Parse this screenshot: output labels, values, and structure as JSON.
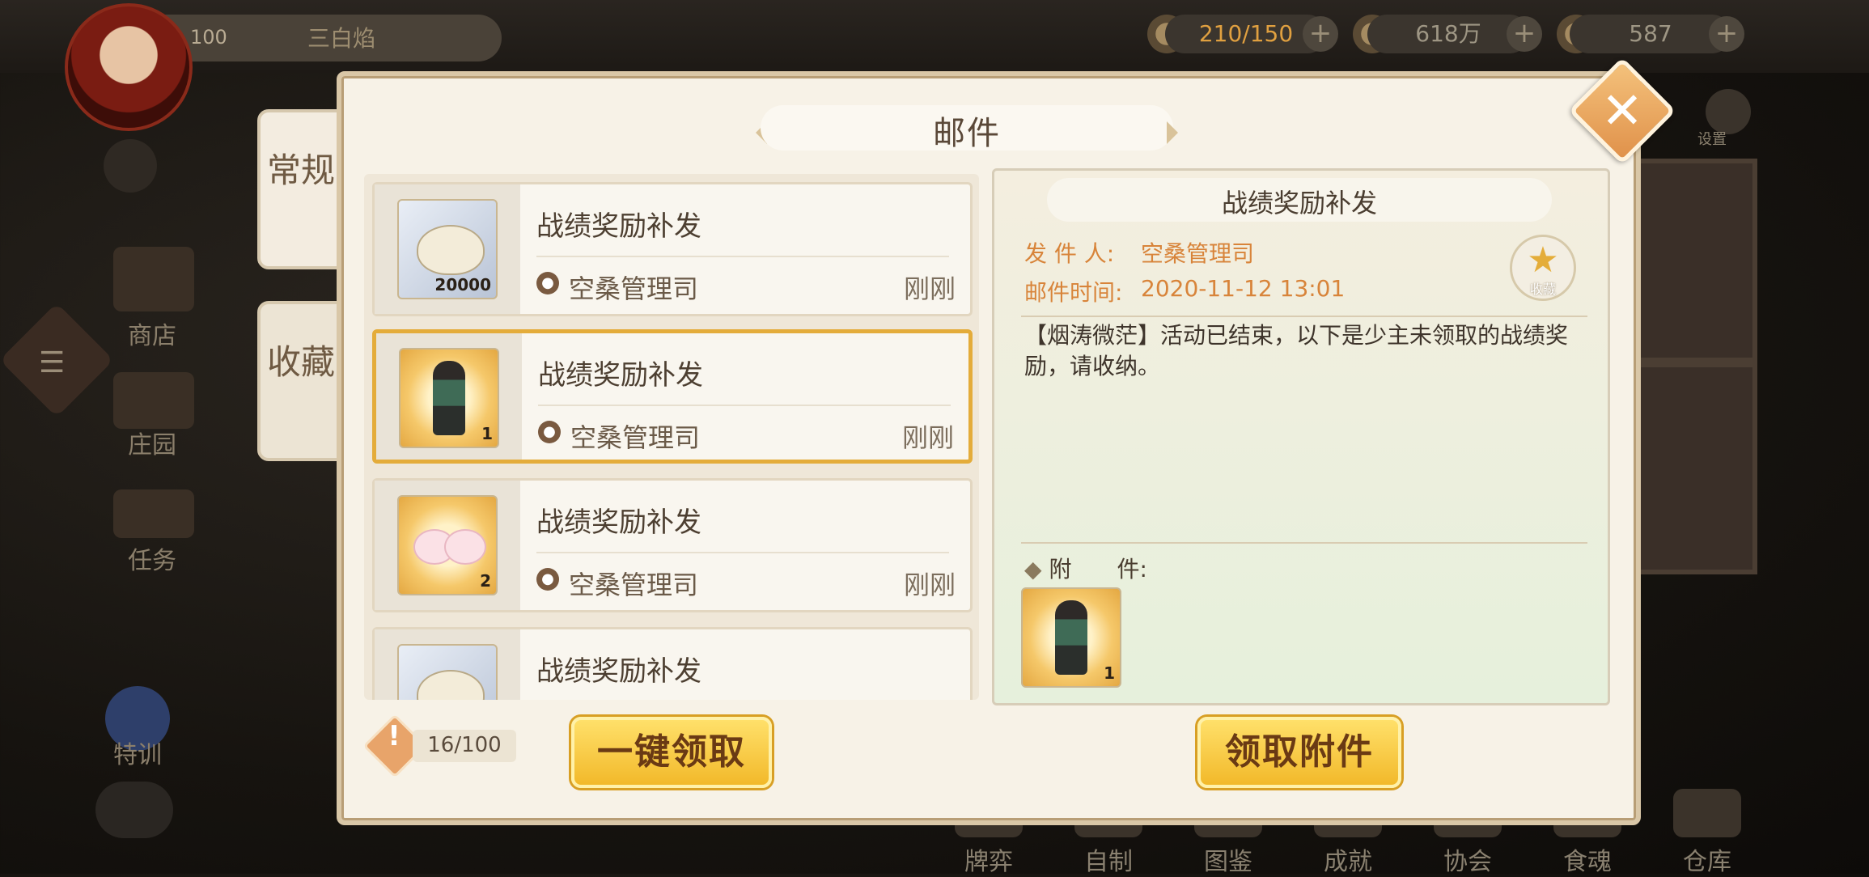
{
  "hud": {
    "player_level": "100",
    "player_name": "三白焰",
    "resources": [
      {
        "icon": "food-bowl-icon",
        "value": "210/150",
        "value_color": "#e0a040"
      },
      {
        "icon": "feather-icon",
        "value": "618万"
      },
      {
        "icon": "coin-icon",
        "value": "587"
      }
    ],
    "settings_label": "设置"
  },
  "left_menu": [
    {
      "label": "商店",
      "icon": "shop-icon"
    },
    {
      "label": "庄园",
      "icon": "manor-icon"
    },
    {
      "label": "任务",
      "icon": "task-icon"
    },
    {
      "label": "特训",
      "icon": "training-icon"
    }
  ],
  "bottom_nav": [
    {
      "label": "牌弈",
      "icon": "cards-icon"
    },
    {
      "label": "自制",
      "icon": "craft-icon"
    },
    {
      "label": "图鉴",
      "icon": "album-icon"
    },
    {
      "label": "成就",
      "icon": "achievement-icon"
    },
    {
      "label": "协会",
      "icon": "guild-icon"
    },
    {
      "label": "食魂",
      "icon": "food-soul-icon"
    },
    {
      "label": "仓库",
      "icon": "warehouse-icon"
    }
  ],
  "mail": {
    "title": "邮件",
    "tabs": [
      {
        "label": "常规",
        "active": true
      },
      {
        "label": "收藏",
        "active": false
      }
    ],
    "items": [
      {
        "title": "战绩奖励补发",
        "sender": "空桑管理司",
        "time": "刚刚",
        "thumb": "silver",
        "count": "20000",
        "selected": false
      },
      {
        "title": "战绩奖励补发",
        "sender": "空桑管理司",
        "time": "刚刚",
        "thumb": "gold",
        "count": "1",
        "selected": true
      },
      {
        "title": "战绩奖励补发",
        "sender": "空桑管理司",
        "time": "刚刚",
        "thumb": "gold",
        "count": "2",
        "selected": false
      },
      {
        "title": "战绩奖励补发",
        "sender": "",
        "time": "",
        "thumb": "silver",
        "count": "",
        "selected": false
      }
    ],
    "detail": {
      "title": "战绩奖励补发",
      "sender_label": "发 件 人:",
      "sender": "空桑管理司",
      "time_label": "邮件时间:",
      "time": "2020-11-12 13:01",
      "favorite_label": "收藏",
      "body": "【烟涛微茫】活动已结束，以下是少主未领取的战绩奖励，请收纳。",
      "attachments_label": "附　　件:",
      "attachment_count": "1"
    },
    "mail_count": "16/100",
    "claim_all_label": "一键领取",
    "claim_attachment_label": "领取附件"
  }
}
